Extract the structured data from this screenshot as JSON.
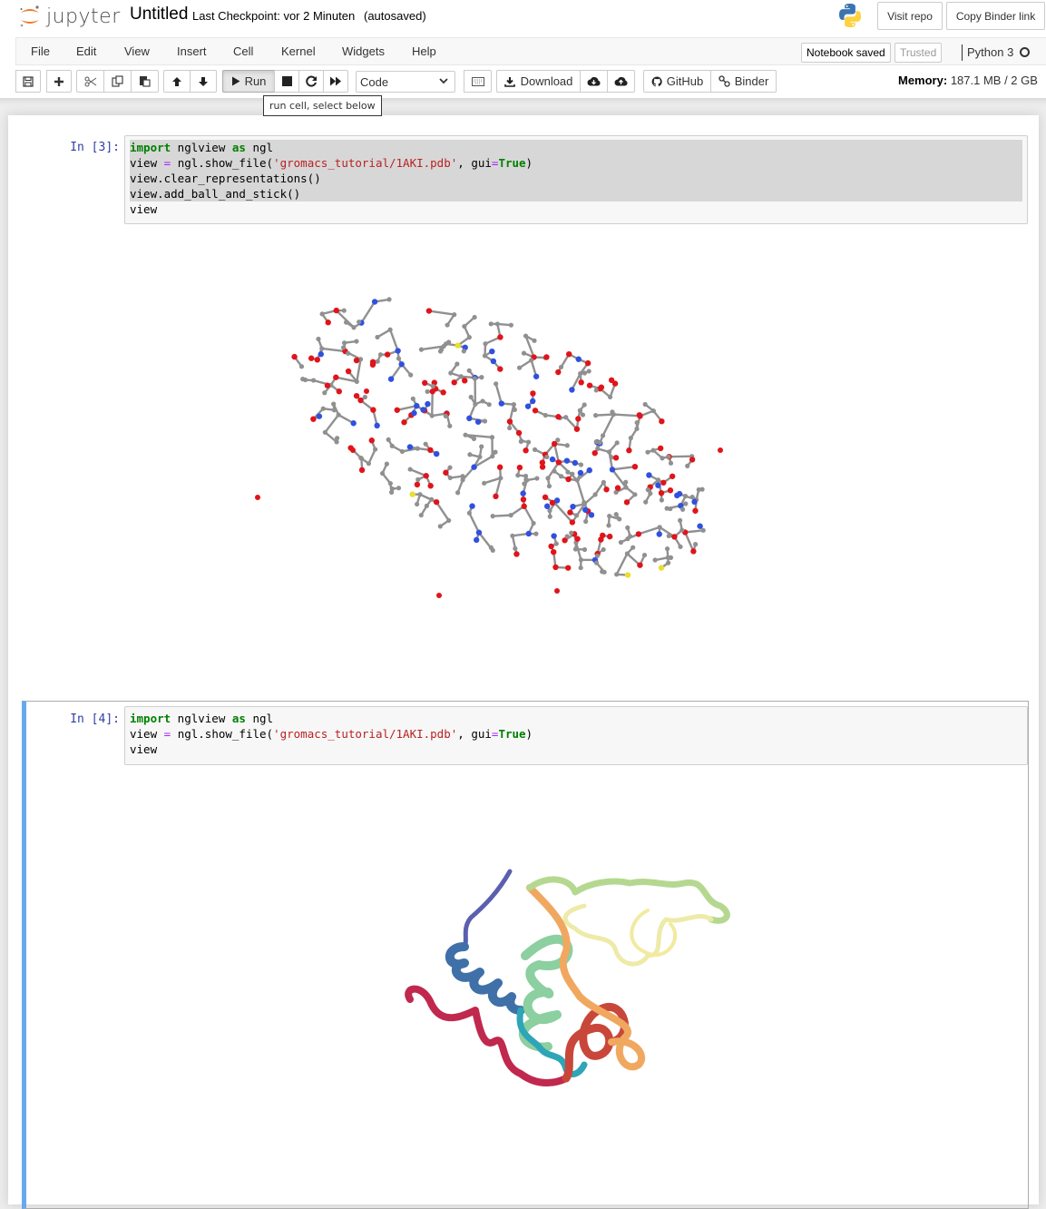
{
  "header": {
    "logo_text": "jupyter",
    "notebook_title": "Untitled",
    "checkpoint": "Last Checkpoint: vor 2 Minuten",
    "autosave": "(autosaved)",
    "buttons": {
      "visit_repo": "Visit repo",
      "copy_binder_link": "Copy Binder link"
    }
  },
  "menubar": {
    "items": [
      "File",
      "Edit",
      "View",
      "Insert",
      "Cell",
      "Kernel",
      "Widgets",
      "Help"
    ],
    "notebook_status": "Notebook saved",
    "trusted": "Trusted",
    "kernel_name": "Python 3",
    "kernel_state": "idle"
  },
  "toolbar": {
    "run_label": "Run",
    "cell_type": "Code",
    "download_label": "Download",
    "github_label": "GitHub",
    "binder_label": "Binder",
    "memory_label": "Memory:",
    "memory_value": "187.1 MB / 2 GB",
    "tooltip": "run cell, select below",
    "icons": [
      "save-icon",
      "plus-icon",
      "cut-icon",
      "copy-icon",
      "paste-icon",
      "arrow-up-icon",
      "arrow-down-icon",
      "play-icon",
      "stop-icon",
      "restart-icon",
      "fast-forward-icon",
      "keyboard-icon",
      "download-icon",
      "cloud-download-icon",
      "cloud-upload-icon",
      "github-icon",
      "link-icon"
    ]
  },
  "cells": [
    {
      "prompt": "In [3]:",
      "selected": false,
      "lines": [
        [
          {
            "t": "import",
            "c": "kw"
          },
          {
            "t": " nglview "
          },
          {
            "t": "as",
            "c": "kw"
          },
          {
            "t": " ngl"
          }
        ],
        [
          {
            "t": "view "
          },
          {
            "t": "=",
            "c": "op"
          },
          {
            "t": " ngl.show_file("
          },
          {
            "t": "'gromacs_tutorial/1AKI.pdb'",
            "c": "str"
          },
          {
            "t": ", gui"
          },
          {
            "t": "=",
            "c": "op"
          },
          {
            "t": "True",
            "c": "bool"
          },
          {
            "t": ")"
          }
        ],
        [
          {
            "t": "view.clear_representations()"
          }
        ],
        [
          {
            "t": "view.add_ball_and_stick()"
          }
        ],
        [
          {
            "t": "view"
          }
        ]
      ],
      "output": {
        "type": "ball-and-stick",
        "structure": "1AKI"
      }
    },
    {
      "prompt": "In [4]:",
      "selected": true,
      "lines": [
        [
          {
            "t": "import",
            "c": "kw"
          },
          {
            "t": " nglview "
          },
          {
            "t": "as",
            "c": "kw"
          },
          {
            "t": " ngl"
          }
        ],
        [
          {
            "t": "view "
          },
          {
            "t": "=",
            "c": "op"
          },
          {
            "t": " ngl.show_file("
          },
          {
            "t": "'gromacs_tutorial/1AKI.pdb'",
            "c": "str"
          },
          {
            "t": ", gui"
          },
          {
            "t": "=",
            "c": "op"
          },
          {
            "t": "True",
            "c": "bool"
          },
          {
            "t": ")"
          }
        ],
        [
          {
            "t": "view"
          }
        ]
      ],
      "output": {
        "type": "cartoon",
        "structure": "1AKI"
      }
    }
  ],
  "colors": {
    "selected_cell_border": "#66a9f0",
    "prompt": "#303f9f",
    "carbon": "#909090",
    "oxygen": "#e0141a",
    "nitrogen": "#3050e0",
    "sulfur": "#e8e030"
  }
}
